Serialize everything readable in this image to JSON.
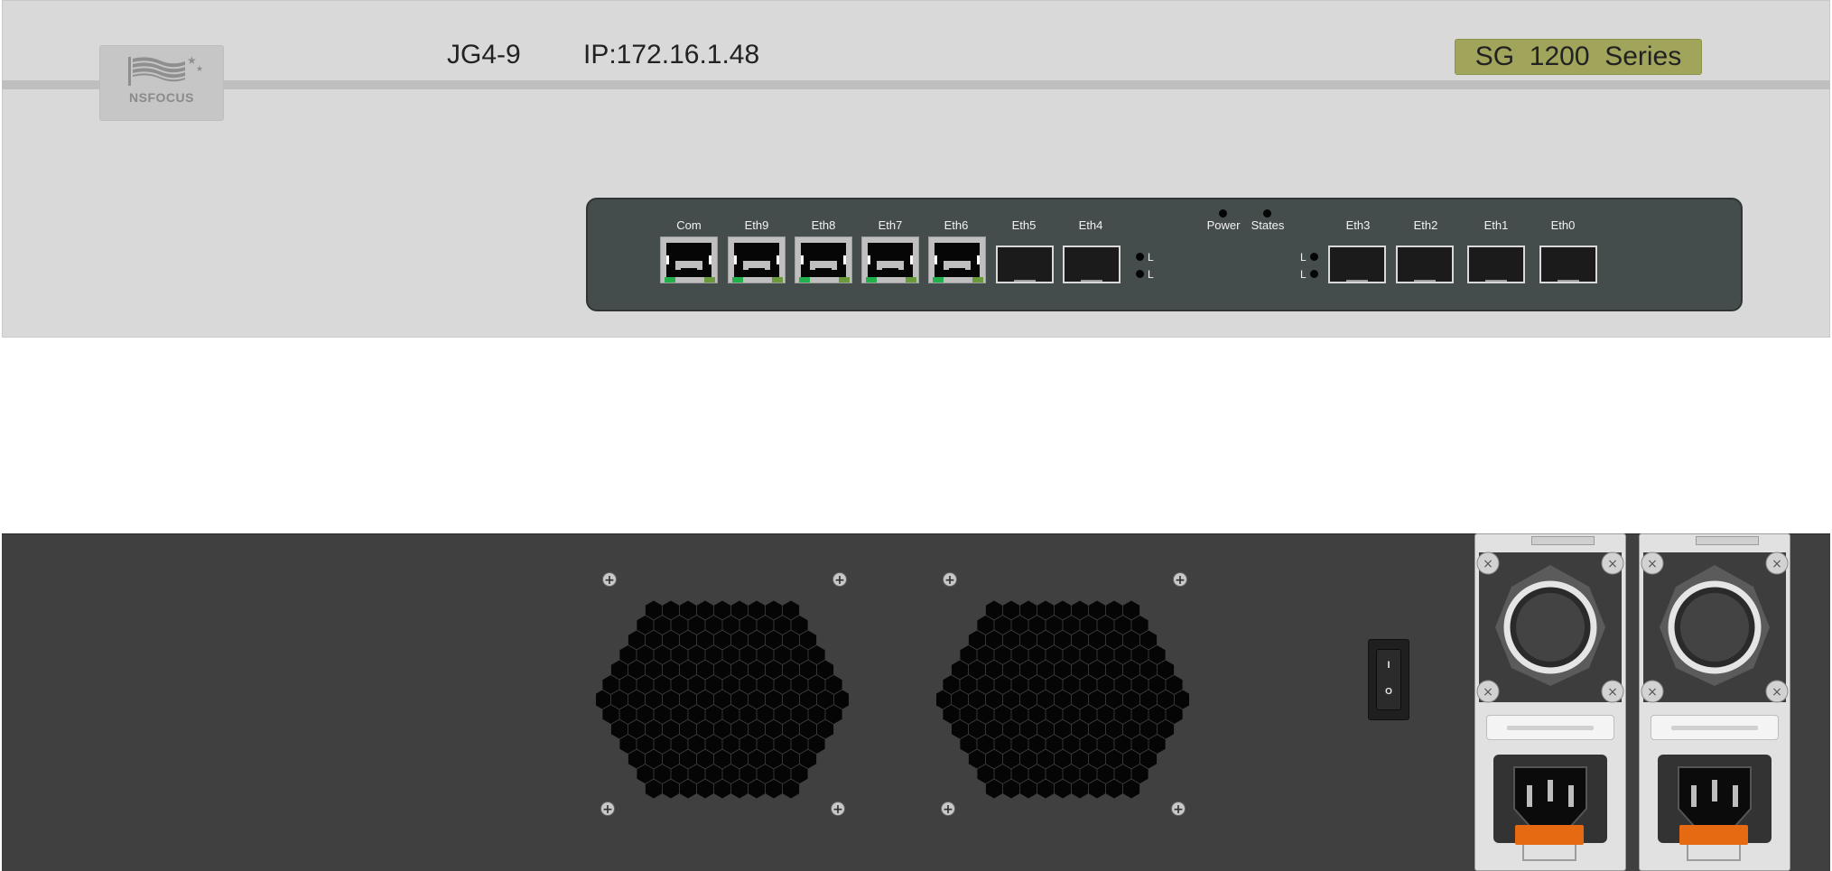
{
  "front_panel": {
    "logo_text": "NSFOCUS",
    "device_name": "JG4-9",
    "ip_address": "IP:172.16.1.48",
    "series_badge": "SG  1200  Series",
    "rj45_ports": [
      "Com",
      "Eth9",
      "Eth8",
      "Eth7",
      "Eth6"
    ],
    "sfp_ports_left": [
      "Eth5",
      "Eth4"
    ],
    "sfp_ports_right": [
      "Eth3",
      "Eth2",
      "Eth1",
      "Eth0"
    ],
    "indicators": [
      "Power",
      "States"
    ],
    "link_led_label": "L"
  },
  "rear_panel": {
    "power_switch": {
      "on_symbol": "I",
      "off_symbol": "O"
    },
    "fan_count": 2,
    "psu_count": 2
  },
  "colors": {
    "chassis_front": "#d9d9d9",
    "chassis_rear": "#404040",
    "port_panel": "#454c4c",
    "series_badge": "#a1a55b",
    "psu_latch": "#e66a12",
    "link_led_green": "#22b04a"
  }
}
